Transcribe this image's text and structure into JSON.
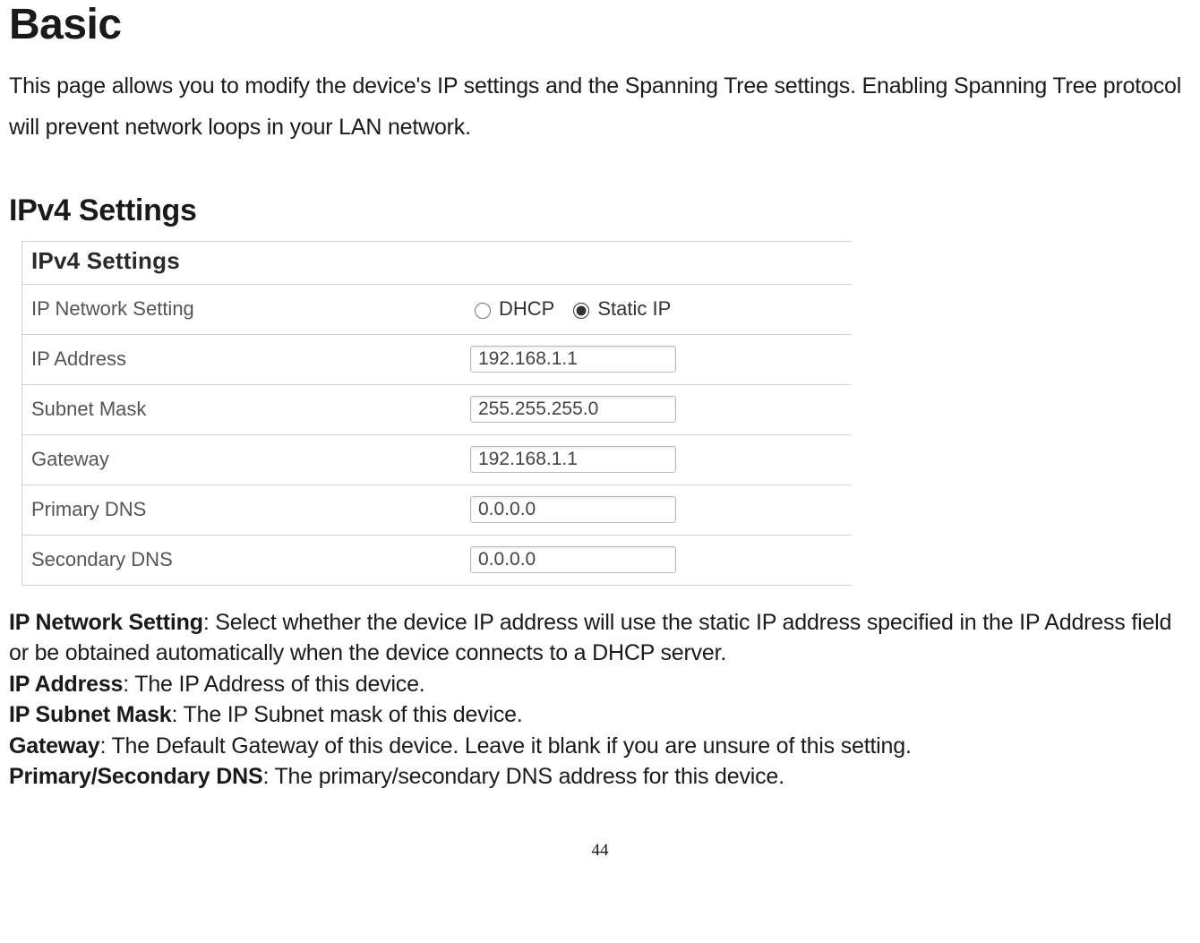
{
  "page": {
    "title": "Basic",
    "intro": "This page allows you to modify the device's IP settings and the Spanning Tree settings. Enabling Spanning Tree protocol will prevent network loops in your LAN network.",
    "section_heading": "IPv4 Settings",
    "page_number": "44"
  },
  "panel": {
    "header": "IPv4 Settings",
    "network_setting": {
      "label": "IP Network Setting",
      "option_dhcp": "DHCP",
      "option_static": "Static IP",
      "selected": "static"
    },
    "ip_address": {
      "label": "IP Address",
      "value": "192.168.1.1"
    },
    "subnet_mask": {
      "label": "Subnet Mask",
      "value": "255.255.255.0"
    },
    "gateway": {
      "label": "Gateway",
      "value": "192.168.1.1"
    },
    "primary_dns": {
      "label": "Primary DNS",
      "value": "0.0.0.0"
    },
    "secondary_dns": {
      "label": "Secondary DNS",
      "value": "0.0.0.0"
    }
  },
  "defs": {
    "ip_network_setting_term": "IP Network Setting",
    "ip_network_setting_text": ": Select whether the device IP address will use the static IP address specified in the IP Address field or be obtained automatically when the device connects to a DHCP server.",
    "ip_address_term": "IP Address",
    "ip_address_text": ": The IP Address of this device.",
    "ip_subnet_term": "IP Subnet Mask",
    "ip_subnet_text": ": The IP Subnet mask of this device.",
    "gateway_term": "Gateway",
    "gateway_text": ": The Default Gateway of this device. Leave it blank if you are unsure of this setting.",
    "dns_term": "Primary/Secondary DNS",
    "dns_text": ": The primary/secondary DNS address for this device."
  }
}
